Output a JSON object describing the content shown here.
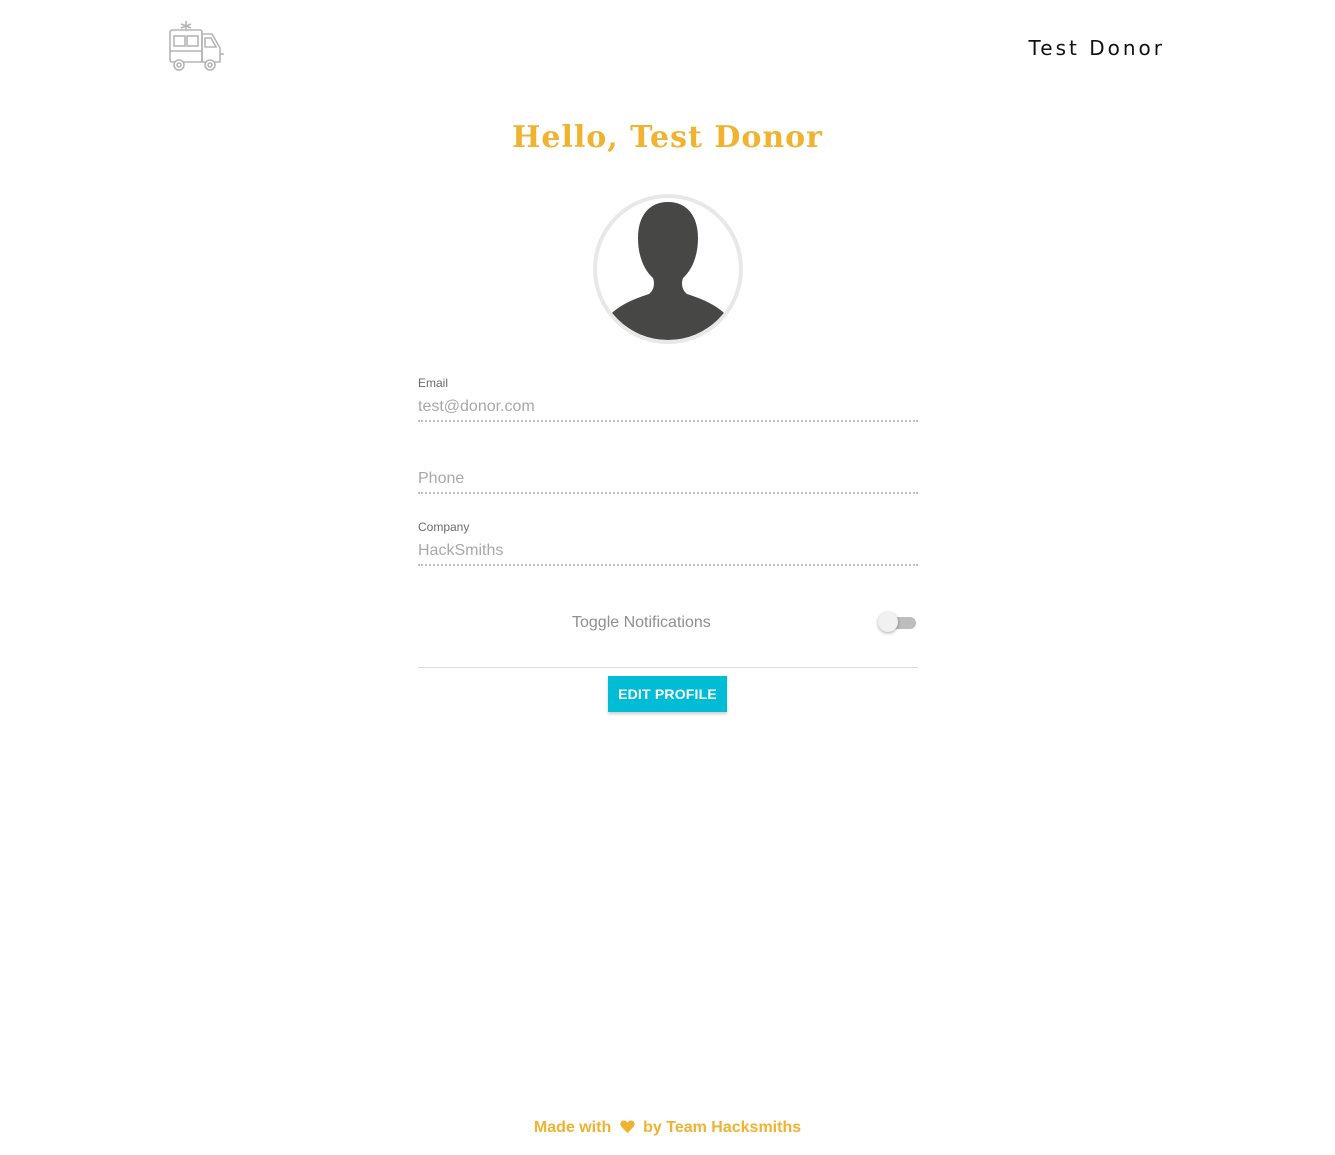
{
  "header": {
    "user_name": "Test Donor"
  },
  "greeting": "Hello, Test Donor",
  "form": {
    "email": {
      "label": "Email",
      "value": "test@donor.com"
    },
    "phone": {
      "placeholder": "Phone",
      "value": ""
    },
    "company": {
      "label": "Company",
      "value": "HackSmiths"
    },
    "notifications": {
      "label": "Toggle Notifications",
      "enabled": false
    }
  },
  "actions": {
    "edit_profile_label": "EDIT PROFILE"
  },
  "footer": {
    "made_with": "Made with",
    "by_team": "by Team Hacksmiths"
  },
  "icons": {
    "logo": "food-truck-icon",
    "avatar": "person-silhouette-icon",
    "heart": "heart-icon"
  },
  "colors": {
    "accent": "#f0b22f",
    "button": "#00bcd4",
    "avatar_fill": "#474745"
  }
}
